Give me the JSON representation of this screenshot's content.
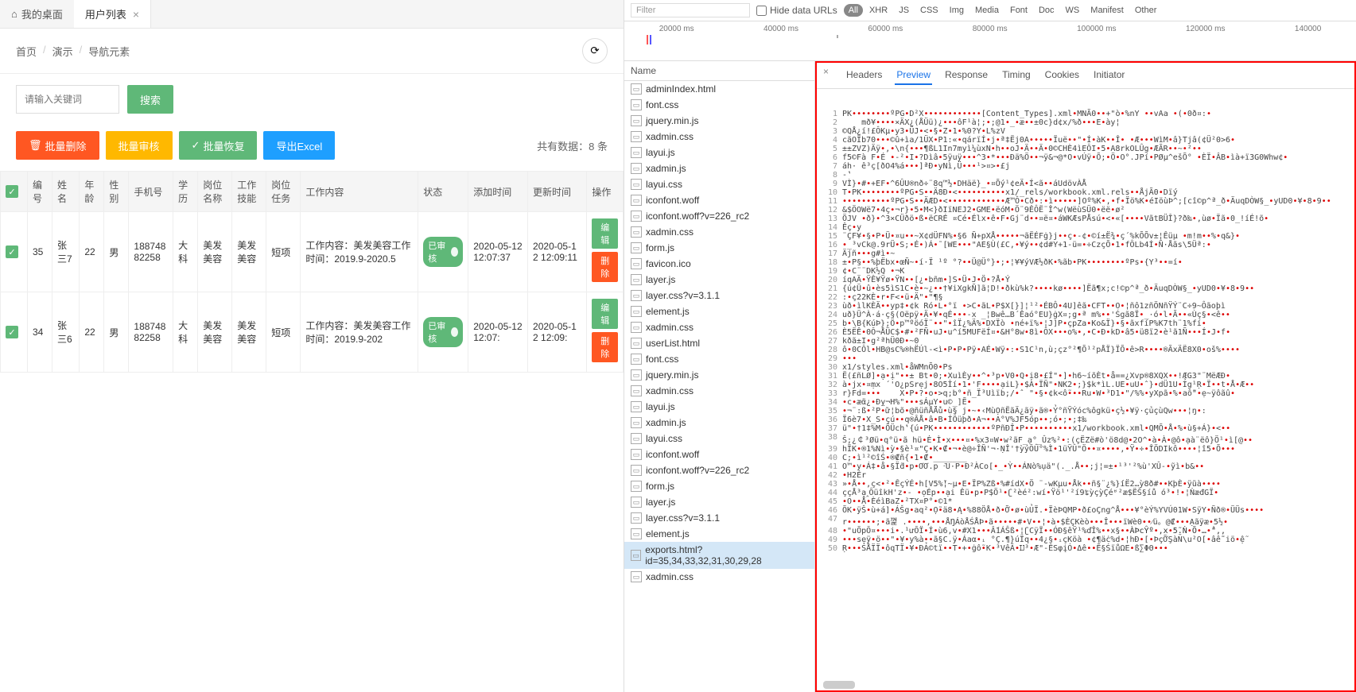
{
  "tabs": {
    "home": "我的桌面",
    "current": "用户列表"
  },
  "breadcrumb": [
    "首页",
    "演示",
    "导航元素"
  ],
  "search": {
    "placeholder": "请输入关键词",
    "button": "搜索"
  },
  "actions": {
    "batch_delete": "批量删除",
    "batch_audit": "批量审核",
    "batch_restore": "批量恢复",
    "export_excel": "导出Excel"
  },
  "data_count": "共有数据：8 条",
  "table": {
    "headers": [
      "编号",
      "姓名",
      "年龄",
      "性别",
      "手机号",
      "学历",
      "岗位名称",
      "工作技能",
      "岗位任务",
      "工作内容",
      "状态",
      "添加时间",
      "更新时间",
      "操作"
    ],
    "rows": [
      {
        "id": "35",
        "name": "张三7",
        "age": "22",
        "gender": "男",
        "phone": "18874882258",
        "edu": "大科",
        "position": "美发美容",
        "skill": "美发美容",
        "task": "短项",
        "content": "工作内容：美发美容工作时间：2019.9-2020.5",
        "status": "已审核",
        "add_time": "2020-05-12 12:07:37",
        "update_time": "2020-05-12 12:09:11"
      },
      {
        "id": "34",
        "name": "张三6",
        "age": "22",
        "gender": "男",
        "phone": "18874882258",
        "edu": "大科",
        "position": "美发美容",
        "skill": "美发美容",
        "task": "短项",
        "content": "工作内容：美发美容工作时间：2019.9-202",
        "status": "已审核",
        "add_time": "2020-05-12 12:07:",
        "update_time": "2020-05-12 12:09:"
      }
    ],
    "edit": "编辑",
    "delete": "删除"
  },
  "devtools": {
    "filter_placeholder": "Filter",
    "hide_urls": "Hide data URLs",
    "filter_tags": [
      "All",
      "XHR",
      "JS",
      "CSS",
      "Img",
      "Media",
      "Font",
      "Doc",
      "WS",
      "Manifest",
      "Other"
    ],
    "timeline": [
      "20000 ms",
      "40000 ms",
      "60000 ms",
      "80000 ms",
      "100000 ms",
      "120000 ms",
      "140000"
    ],
    "name_header": "Name",
    "requests": [
      "adminIndex.html",
      "font.css",
      "jquery.min.js",
      "xadmin.css",
      "layui.js",
      "xadmin.js",
      "layui.css",
      "iconfont.woff",
      "iconfont.woff?v=226_rc2",
      "xadmin.css",
      "form.js",
      "favicon.ico",
      "layer.js",
      "layer.css?v=3.1.1",
      "element.js",
      "xadmin.css",
      "userList.html",
      "font.css",
      "jquery.min.js",
      "xadmin.css",
      "layui.js",
      "xadmin.js",
      "layui.css",
      "iconfont.woff",
      "iconfont.woff?v=226_rc2",
      "form.js",
      "layer.js",
      "layer.css?v=3.1.1",
      "element.js",
      "exports.html?id=35,34,33,32,31,30,29,28",
      "xadmin.css"
    ],
    "selected_request": 29,
    "detail_tabs": [
      "Headers",
      "Preview",
      "Response",
      "Timing",
      "Cookies",
      "Initiator"
    ],
    "active_detail_tab": 1,
    "preview_lines": [
      "PK••••••••ºPG•D²X••••••••••••[Content_Types].xml•MNÃ0••+\"ò•%nY ••vAa •(•0ð¤:•",
      "    mð¥••••×ÄX¿(ÅÜü)¿•••ôF¹à¦;•;@1•_•æ••±0c}d¢x/%ð•••E•ày¦",
      "©QÅ¿í!£ÔKµ•y3•ÜJ•<•§•Z•1•%0?Y•L%zV",
      "cãOÏb70•••©û+ìa/1ÜX•P1:«•qárïÍ•j•ª‡Ëj0A•••••Ïuë••\"•Í•àK••Î• •Æ•••WìM•â}Tjâ(¢Ü²0>6•",
      "±±ZVZ)Äÿ•,•\\n{•••¶ßL1In7myì¼ùxN•h••oJ•Ä••Ä•0©CHÈ4ìEÔI•5•A8rkOLÛg•ÆÃR••~•²••",
      "f5©Fà F•É •-²•I•?Dìâ•5ÿuÿ•••^3•*•••Ðä%Ö••¬ÿ&¬@*O•vÚÿ•Õ;•Ö•O°.JPí•PØµ^ešÕ° •ÈÏ•ÂB•ìà+ï3G0Whw¢•",
      "áh· ê³ç[ðO4%á•••]ªÐ•yNì,Ü•••¹>¤>•£j",
      "-‛",
      "VÌ}•#•+EF•^6ÛU®nð÷¨8q™½•DHäë}_•¤Õý¹¢eÄ•Í<ã••áUdövÀÅ",
      "T•PK••••••••ºPG•S••Ä8Ð•<••••••••••x1/_rels/workbook.xml.rels••ÅjÃ0•Dïý",
      "••••••••••ºPG•S••ÄÆD•<••••••••••••Æ™Ô•Cð•:•ì•••••]Oº%K•,•f•Ïö%K•éIöùÞ^;[cî©p^ª_ð•ÄuqDÒW§_•yUD0•¥•8•9••",
      "&$ÖOWë7•4ç•¬r}•5•M<}ðIïNEJ2•GME•ëóM•Ö¨9ÊÔË¨Î^w(WëùSÜ0•ëë•ø²",
      "ÖJV •ð}•^3×CÜðö•ß•ëCRÉ ¤Cé•Élx•ê•F•Gj¨d••¤ë¤•áWKÆsPÅsú•<•«[••••VãtBÜÎ}?ð‰•,ùø•Ïã•0_!íÉ!õ•",
      "Êç•y",
      "¨ÇF¥•§•P•Ü•¤u••~X¢dÜFN%•§6 Ñ+pXÅ•••••¬ãËÉFġ}j••ç•-¢•©í±Ë¾•ç´%kÕÕv±¦Êüµ •m!m••%•q&}•",
      "•_³vCk@.9rÜ•S;•É•)Á•˜[WE•••\"AE§Ù(£C,•¥ý••¢d#Y+1-ü=•÷CzçÕ•1•fÔLb4Í•Ñ·Åãs\\5Üª:•",
      "Äjñ•••g#ì•~",
      "±•P§••%þËbx•œÑ~•í·Ï ¹º °?••Ü@Ü°}•;•¦¥¥ýVÆ½ðK•%ãb•PK••••••••ºPs•{Y³••=í•",
      "¢•C¨¨DK½Q •¬K",
      "íqAÄ•ŸÊ¥Ÿø•ŸN••[¿•bñm•]S•Ü•J•Ö•?Å•Ý",
      "{ú¢Ü•û•ès5ìS1C•è•~¿••†¥iXgkÑ]ã¦D!•ðkù%k?••••kø••••]Ëã¶x;c!©p^ª_ð•ÄuqDÒW§_•yUD0•¥•8•9••",
      ":•ç22KÈ•r•F<•ü•Ä\"•\"¶§",
      "ùð•ìlKÈÄ••yp‡•¢k Ró•L•°ï •>C•ãL•P$X[}]¦¹²•ÉBÔ•4U]êã•CFT••O•¦ñô1zñÖNñŸÝ¨C÷9~Ôãoþì",
      "uð}Ü^À·á·ç§(Oëpÿ•Ä•¥•qÉ•••-x _¦Bwê…B´Êaó°EU}ġX¤;g•ª m%••'Śgã8Ï•_·ó•l•Ã••«Ùç§•<ê••",
      "b•\\B{KúÞ};Ö•p™ºöóÏ¨••\"•îÏ¿%Ä%•DXÏò •né+ï%•¦J]P•çpZa•Ko&Ï}•§•ãxfíP%K7th¨1%fí•",
      "È5ËÊ•0Ô¬ÅÜC$•#•²FÑ•uJ•u^í5MUFëÍ¤•&H°8w•8ì•ÔX•••o%•,•C•Ð•kD•â5•ü8ï2•è¹ã1Ñ•••Í•J•f•",
      "kðã±I•g²ªhÜ0Ð•~0",
      "ô•0CÔl•HB@sC%®hËÚl-<ì•P•P•Pÿ•AÉ•Wÿ•:•S1C¹n,ù;çz°²¶Õ¹²pÅÏ}ÏÕ•ê>R••••®ÃxÄË8X0•oš%••••",
      "•••",
      "x1/styles.xml•åWMnÕ0•Ps",
      "Ë(£ñLØ]•ạ•ị\"••± Bt•0;•XuìÈy••^•³p•V0•Q•ị8•£Í\"•]•h6~íõÈt•å==¿Xvp®8XQX••!ÆG3\"¨MëÆÐ•",
      "à•jx•¤ṃx ´'O¿pSrẹj•8O5İí•1•'F••••ạiL}•$À•ÏÑ\"•NK2•;}$k*ìL.UE•uU•ˆ}•dÜ1U•Ỉg¹Ṛ•Ï••t•Å•Æ••",
      "r}Fd=•••    X•P•?•o•>q;b°•ñ_Ï³Uìïb;/•ˆ \"•§•¢k<ỗ•••Ru•W•³D1•\"/%%•yXpã•%•aỗ\"•ẹ~ÿôãû•",
      "•c•æᾶ¿•Ðỵ¬H%\"•••sÁµY•u©_]Ẽ•",
      "•¬¨:ß•²P•ữ¦bõ•@ñüñÅ̉Ä̉ù•ù§ j•~•‹MùỌñËãÄ¿ãÿ•ã®•Ỷ°ñỸÝóc%ôgkü•ç½•¥ÿ·çủçùQw•••¦ŋ•:",
      "Ï6è7•X_S•çú••q®ÂÅ•â•B•ÍÔüþð•A¬••A°V%JF5óp••;ó•;•;‡‰",
      "ü\"•†1‡%M•ÕÜch‛{ú•PK••••••••••••ºPñÐÎ•P••••••••••x1/workbook.xml•QMÕ•Å•%•ù§+Á}•<••",
      "Ŝ;¿￠³Øü•q°ü•ã hü•Ė•Ì•x•••¤•%x3¤W•w²ãF_ạ°_Ûz%²•:(çËZë#ò'ö8d@•2O^•à•À•@ô•ạà¨ëô}Ö¹•ì[@••",
      "hÏK•®1%Nì•ỳ•§è¹¤\"Ç•K•₡•¬•è@÷ÎÑ'¬·ṆÎ'†ỳýŌÛ°%Ì•1üŸÛ\"Ö••¤••••,•Ÿ•÷•ÎÖDIkô••••¦î5•Õ•••",
      "C;•ì¹²©îŚ•®₡ñ{•1•₡•_______",
      "O™•y•Á‡•å•§Ï̃d•p•ƠƠ.p ·͂U·P•Ð²ÀCo[•_•Ỳ••ÁNò%ụä\"(._.Å••;j¦=±•¹³'²%ù'XÛ-•ỹì•b&••",
      "•H2Ér",
      "»•Å••,ç<•²•ÊçÝÉ•h[V5%̃¦~µ•E•ÏP%Zß•%#ídX•Ö ¨-wKµu•Åk••ñ§¨¿%}́íË2…ỳ8ð#••KþÈ•ÿũà••••",
      "ççÅ³ạ‸ÔüîkH'z•- •ọÉp••ại Êü•p•P$Ö¹•ʗ²èé²:wí•Ÿö¹'²í9ʨỳçỳÇéʶ²æ$ËŠ§íů ó³•!•¦ṄæđGÏ•",
      "•O••Å•ÈéìBaZ•²TX¤P°•©1*",
      "ÕK•ÿŠ•ù+á]•ÁŠg•aq²•Ọ̃•ä8•Ą•%88ÖÅ•ð•Ỡ•ø•ùỦÏ.•ÏèÞQMP•ð£oÇng^Å•••¥°èÝ%YVÚ01W•SÿY•Ñð®•ÜÜs••••",
      "r••••••;•ã꼁 .••••,•••ÅŊÁòÅŚÅÞ•ã•••••#•V••¦•à•$ÈÇKèò•••Î•••ïWè0••⁄ü。@₡•••Ạãÿæ•5½•",
      "•\"uÕpŌ¤•••i•.¹ưŌÏ•Í•ù6,v•#X1•••Ấ1ÁŜß•¦ʗCÿÏ••ÓÐ§êŸ¹%ďÎ%••x§<i¨è••ÀÞcŶº•,x•5̃.Ṅ•Õ•…•̉\",,",
      "•••sẹÿ•ö••\"•¥•y%à••ã§C.ÿ•Áaα•ᵢ °Ç.¶}úÏq••4¿§•ᵢçKöà •¢¶äċ%d•¦hĐ•[•ÞçỠŞàN̄\\u²O[•âễ¨iö•ệ̃",
      "Ṛ•••ŚÅÏÏ•ôqTÏ•¥•ĐẢ©tï••Τ•+•ġỗ•Κ•³VêĀ•Ĳ³•Æ\"-ÊSφįÓ•Δê••Ẽ§ŚïůΩΕ•ß∑ΦΘ•••"
    ]
  }
}
